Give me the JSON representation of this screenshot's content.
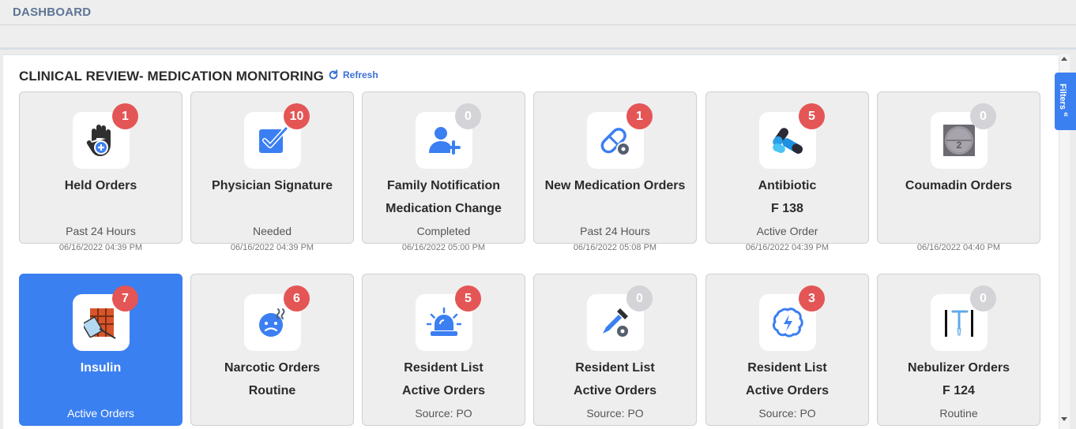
{
  "header": {
    "title": "DASHBOARD"
  },
  "panel": {
    "title": "CLINICAL REVIEW- MEDICATION MONITORING",
    "refresh_label": "Refresh"
  },
  "filters": {
    "label": "Filters",
    "chevron": "«"
  },
  "colors": {
    "accent": "#3b80f0",
    "badge_alert": "#e45555",
    "badge_zero": "#d3d3d8",
    "icon_blue": "#3b7ff2"
  },
  "cards": [
    {
      "title1": "Held Orders",
      "title2": "",
      "sub": "Past 24 Hours",
      "time": "06/16/2022 04:39 PM",
      "count": "1",
      "icon": "hand-plus-icon"
    },
    {
      "title1": "Physician Signature",
      "title2": "",
      "sub": "Needed",
      "time": "06/16/2022 04:39 PM",
      "count": "10",
      "icon": "checkbox-icon"
    },
    {
      "title1": "Family Notification",
      "title2": "Medication Change",
      "sub": "Completed",
      "time": "06/16/2022 05:00 PM",
      "count": "0",
      "icon": "user-plus-icon"
    },
    {
      "title1": "New Medication Orders",
      "title2": "",
      "sub": "Past 24 Hours",
      "time": "06/16/2022 05:08 PM",
      "count": "1",
      "icon": "capsule-gear-icon"
    },
    {
      "title1": "Antibiotic",
      "title2": "F 138",
      "sub": "Active Order",
      "time": "06/16/2022 04:39 PM",
      "count": "5",
      "icon": "pills-icon"
    },
    {
      "title1": "Coumadin Orders",
      "title2": "",
      "sub": "",
      "time": "06/16/2022 04:40 PM",
      "count": "0",
      "icon": "coumadin-pill-icon"
    },
    {
      "title1": "Insulin",
      "title2": "",
      "sub": "Active Orders",
      "time": "",
      "count": "7",
      "icon": "insulin-icon"
    },
    {
      "title1": "Narcotic Orders",
      "title2": "Routine",
      "sub": "",
      "time": "",
      "count": "6",
      "icon": "face-sweat-icon"
    },
    {
      "title1": "Resident List",
      "title2": "Active Orders",
      "sub": "Source: PO",
      "time": "",
      "count": "5",
      "icon": "siren-icon"
    },
    {
      "title1": "Resident List",
      "title2": "Active Orders",
      "sub": "Source: PO",
      "time": "",
      "count": "0",
      "icon": "dropper-gear-icon"
    },
    {
      "title1": "Resident List",
      "title2": "Active Orders",
      "sub": "Source: PO",
      "time": "",
      "count": "3",
      "icon": "brain-bolt-icon"
    },
    {
      "title1": "Nebulizer Orders",
      "title2": "F 124",
      "sub": "Routine",
      "time": "",
      "count": "0",
      "icon": "nebulizer-icon"
    }
  ]
}
